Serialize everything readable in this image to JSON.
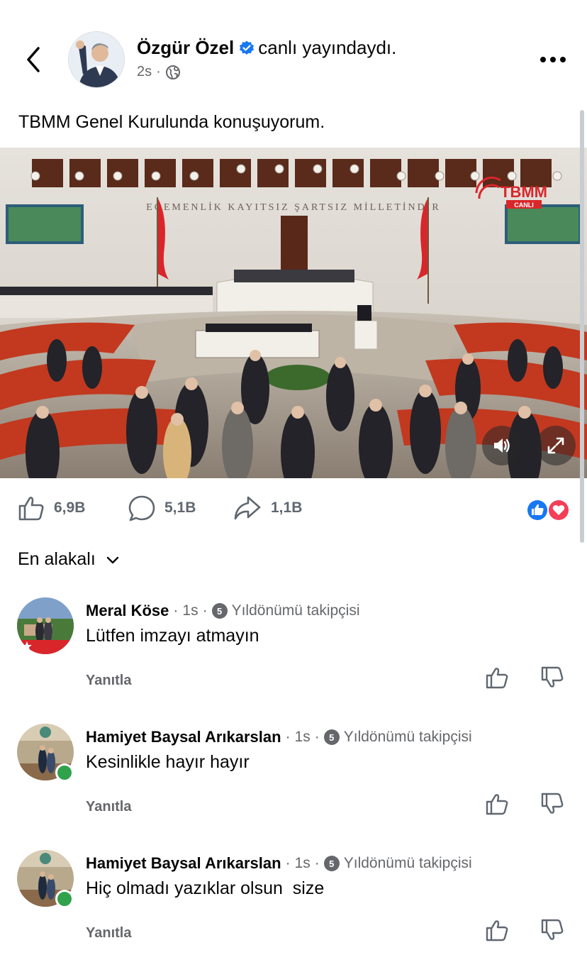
{
  "header": {
    "author": "Özgür Özel",
    "action_text": "canlı yayındaydı.",
    "time": "2s",
    "separator": "·",
    "privacy_icon": "globe-icon",
    "back_icon": "chevron-left-icon",
    "more_icon": "more-horizontal-icon"
  },
  "post": {
    "text": "TBMM Genel Kurulunda konuşuyorum.",
    "video": {
      "banner_text": "EGEMENLİK KAYITSIZ ŞARTSIZ MİLLETİNDİR",
      "logo_text": "TBMM",
      "logo_subtext": "CANLI",
      "sound_icon": "speaker-icon",
      "fullscreen_icon": "expand-icon"
    }
  },
  "stats": {
    "likes": "6,9B",
    "comments": "5,1B",
    "shares": "1,1B",
    "reaction_icons": [
      "like-reaction-icon",
      "love-reaction-icon"
    ]
  },
  "sort": {
    "label": "En alakalı"
  },
  "comments": [
    {
      "name": "Meral Köse",
      "time": "1s",
      "badge_number": "5",
      "badge_label": "Yıldönümü takipçisi",
      "text": "Lütfen imzayı atmayın",
      "reply_label": "Yanıtla",
      "online": false
    },
    {
      "name": "Hamiyet Baysal Arıkarslan",
      "time": "1s",
      "badge_number": "5",
      "badge_label": "Yıldönümü takipçisi",
      "text": "Kesinlikle hayır hayır",
      "reply_label": "Yanıtla",
      "online": true
    },
    {
      "name": "Hamiyet Baysal Arıkarslan",
      "time": "1s",
      "badge_number": "5",
      "badge_label": "Yıldönümü takipçisi",
      "text": "Hiç olmadı yazıklar olsun  size",
      "reply_label": "Yanıtla",
      "online": true
    }
  ],
  "colors": {
    "verified_blue": "#1877f2",
    "secondary_text": "#65676b",
    "online_green": "#31a24c",
    "love_red": "#f33e58",
    "tbmm_red": "#d9262b"
  }
}
